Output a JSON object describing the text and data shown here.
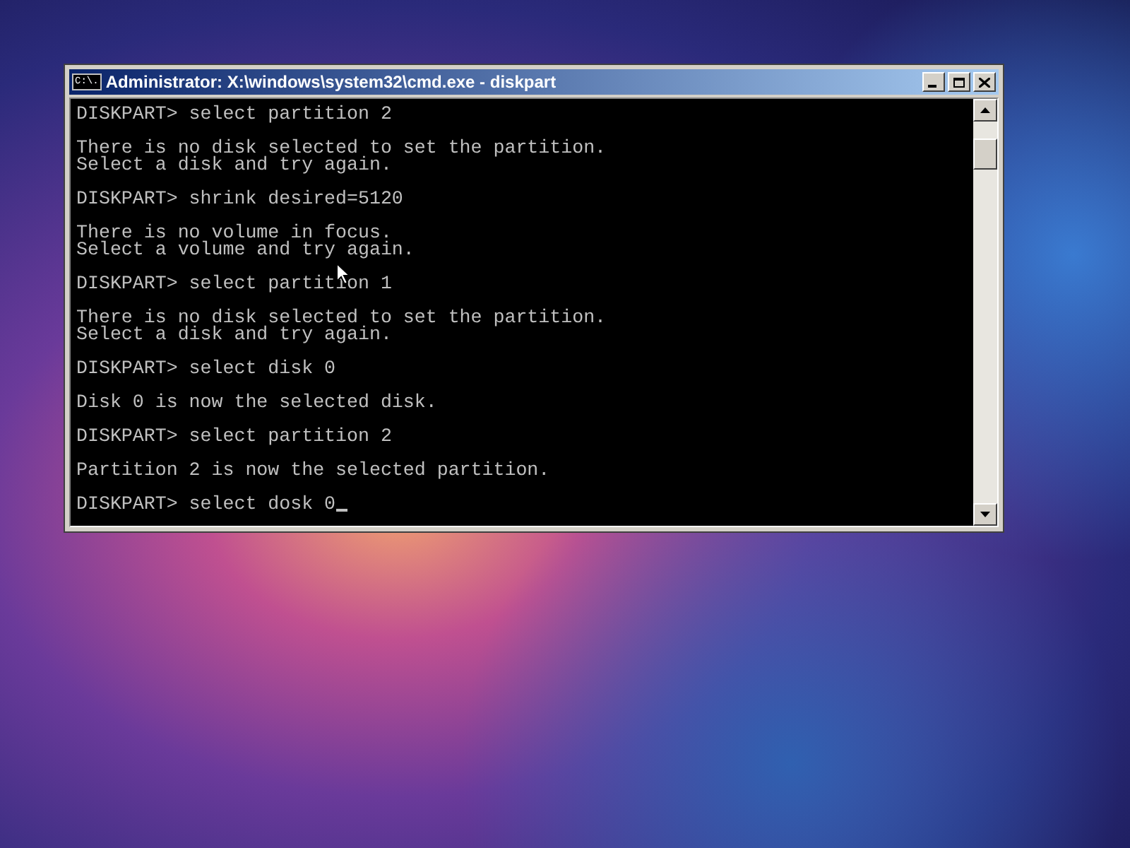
{
  "window": {
    "title": "Administrator: X:\\windows\\system32\\cmd.exe - diskpart",
    "icon_text": "C:\\."
  },
  "console": {
    "groups": [
      [
        "DISKPART> select partition 2"
      ],
      [
        "There is no disk selected to set the partition.",
        "Select a disk and try again."
      ],
      [
        "DISKPART> shrink desired=5120"
      ],
      [
        "There is no volume in focus.",
        "Select a volume and try again."
      ],
      [
        "DISKPART> select partition 1"
      ],
      [
        "There is no disk selected to set the partition.",
        "Select a disk and try again."
      ],
      [
        "DISKPART> select disk 0"
      ],
      [
        "Disk 0 is now the selected disk."
      ],
      [
        "DISKPART> select partition 2"
      ],
      [
        "Partition 2 is now the selected partition."
      ],
      [
        "DISKPART> select dosk 0"
      ]
    ],
    "cursor": true
  }
}
